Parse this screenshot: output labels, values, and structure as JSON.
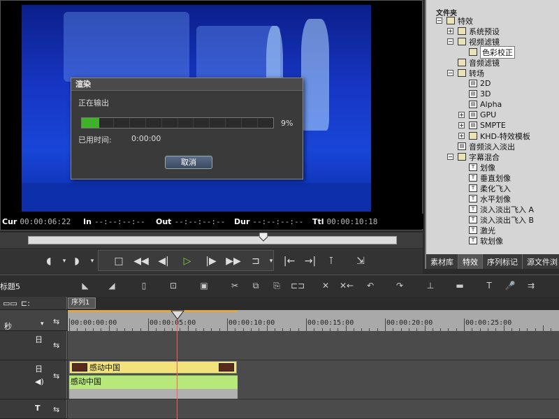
{
  "preview": {
    "timecodes": [
      {
        "label": "Cur",
        "value": "00:00:06:22"
      },
      {
        "label": "In",
        "value": "--:--:--:--"
      },
      {
        "label": "Out",
        "value": "--:--:--:--"
      },
      {
        "label": "Dur",
        "value": "--:--:--:--"
      },
      {
        "label": "Ttl",
        "value": "00:00:10:18"
      }
    ]
  },
  "render_dialog": {
    "title": "渲染",
    "status": "正在输出",
    "progress_percent": 9,
    "progress_label": "9%",
    "elapsed_label": "已用时间:",
    "elapsed_value": "0:00:00",
    "cancel_label": "取消"
  },
  "right_panel": {
    "header": "文件夹",
    "tree": [
      {
        "label": "特效",
        "toggle": "−",
        "icon": "folder",
        "indent": 0
      },
      {
        "label": "系统预设",
        "toggle": "+",
        "icon": "folder",
        "indent": 1
      },
      {
        "label": "视频滤镜",
        "toggle": "−",
        "icon": "folder",
        "indent": 1
      },
      {
        "label": "色彩校正",
        "toggle": "",
        "icon": "folder",
        "indent": 2,
        "selected": true
      },
      {
        "label": "音频滤镜",
        "toggle": "",
        "icon": "folder",
        "indent": 1
      },
      {
        "label": "转场",
        "toggle": "−",
        "icon": "folder",
        "indent": 1
      },
      {
        "label": "2D",
        "toggle": "",
        "icon": "file",
        "indent": 2
      },
      {
        "label": "3D",
        "toggle": "",
        "icon": "file",
        "indent": 2
      },
      {
        "label": "Alpha",
        "toggle": "",
        "icon": "file",
        "indent": 2
      },
      {
        "label": "GPU",
        "toggle": "+",
        "icon": "file",
        "indent": 2
      },
      {
        "label": "SMPTE",
        "toggle": "+",
        "icon": "file",
        "indent": 2
      },
      {
        "label": "KHD-特效模板",
        "toggle": "+",
        "icon": "folder",
        "indent": 2
      },
      {
        "label": "音频淡入淡出",
        "toggle": "",
        "icon": "file",
        "indent": 1
      },
      {
        "label": "字幕混合",
        "toggle": "−",
        "icon": "folder",
        "indent": 1
      },
      {
        "label": "划像",
        "toggle": "",
        "icon": "title",
        "indent": 2
      },
      {
        "label": "垂直划像",
        "toggle": "",
        "icon": "title",
        "indent": 2
      },
      {
        "label": "柔化飞入",
        "toggle": "",
        "icon": "title",
        "indent": 2
      },
      {
        "label": "水平划像",
        "toggle": "",
        "icon": "title",
        "indent": 2
      },
      {
        "label": "淡入淡出飞入 A",
        "toggle": "",
        "icon": "title",
        "indent": 2
      },
      {
        "label": "淡入淡出飞入 B",
        "toggle": "",
        "icon": "title",
        "indent": 2
      },
      {
        "label": "激光",
        "toggle": "",
        "icon": "title",
        "indent": 2
      },
      {
        "label": "软划像",
        "toggle": "",
        "icon": "title",
        "indent": 2
      }
    ],
    "tabs": [
      "素材库",
      "特效",
      "序列标记",
      "源文件浏"
    ],
    "active_tab": 1
  },
  "timeline": {
    "title": "标题5",
    "sequence_tab": "序列1",
    "ruler_labels": [
      "00:00:00:00",
      "00:00:05:00",
      "00:00:10:00",
      "00:00:15:00",
      "00:00:20:00",
      "00:00:25:00"
    ],
    "unit_label": "秒",
    "video_clip_label": "感动中国",
    "audio_clip_label": "感动中国"
  },
  "colors": {
    "accent_progress": "#3db32a",
    "video_clip": "#f2e37a",
    "audio_clip": "#b8e879",
    "playhead": "#ff5a5a"
  }
}
